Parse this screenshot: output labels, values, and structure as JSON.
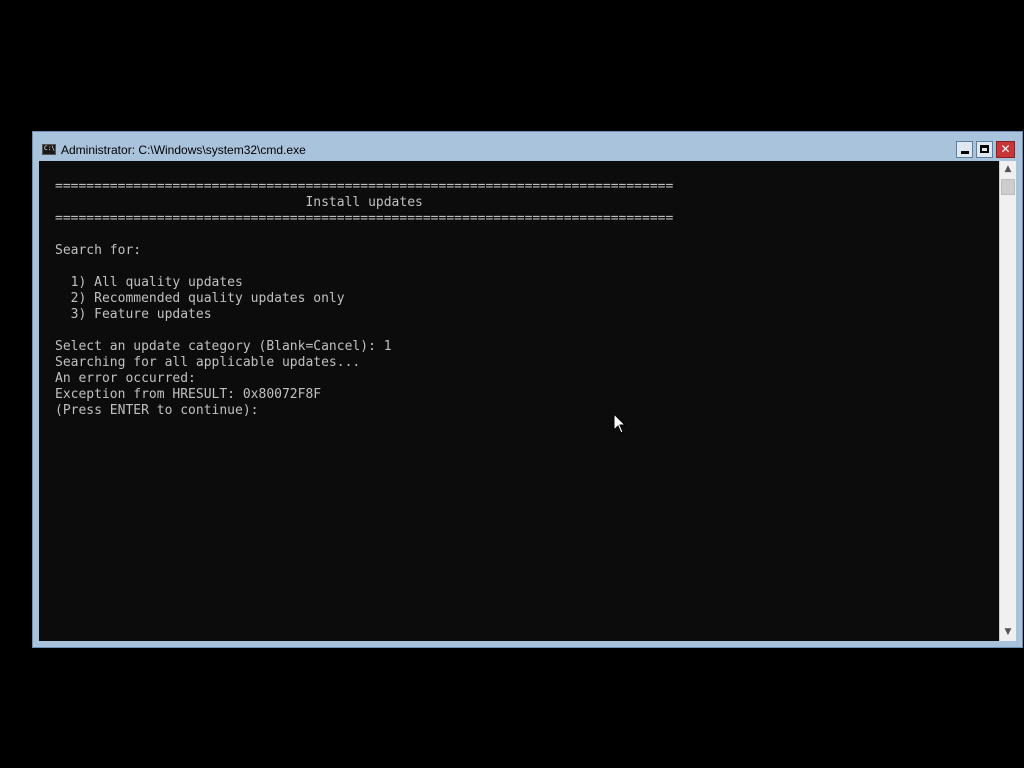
{
  "window": {
    "title": "Administrator: C:\\Windows\\system32\\cmd.exe",
    "icon_label": "C:\\",
    "controls": {
      "minimize": "minimize",
      "maximize": "maximize",
      "close": "✕"
    }
  },
  "console": {
    "lines": [
      "===============================================================================",
      "                                Install updates",
      "===============================================================================",
      "",
      "Search for:",
      "",
      "  1) All quality updates",
      "  2) Recommended quality updates only",
      "  3) Feature updates",
      "",
      "Select an update category (Blank=Cancel): 1",
      "Searching for all applicable updates...",
      "An error occurred:",
      "Exception from HRESULT: 0x80072F8F",
      "(Press ENTER to continue):"
    ]
  },
  "scrollbar": {
    "up_arrow": "▲",
    "down_arrow": "▼"
  },
  "colors": {
    "console_bg": "#0c0c0c",
    "console_text": "#c0c0c0",
    "window_frame": "#aac3dc",
    "close_button": "#c7373a"
  }
}
